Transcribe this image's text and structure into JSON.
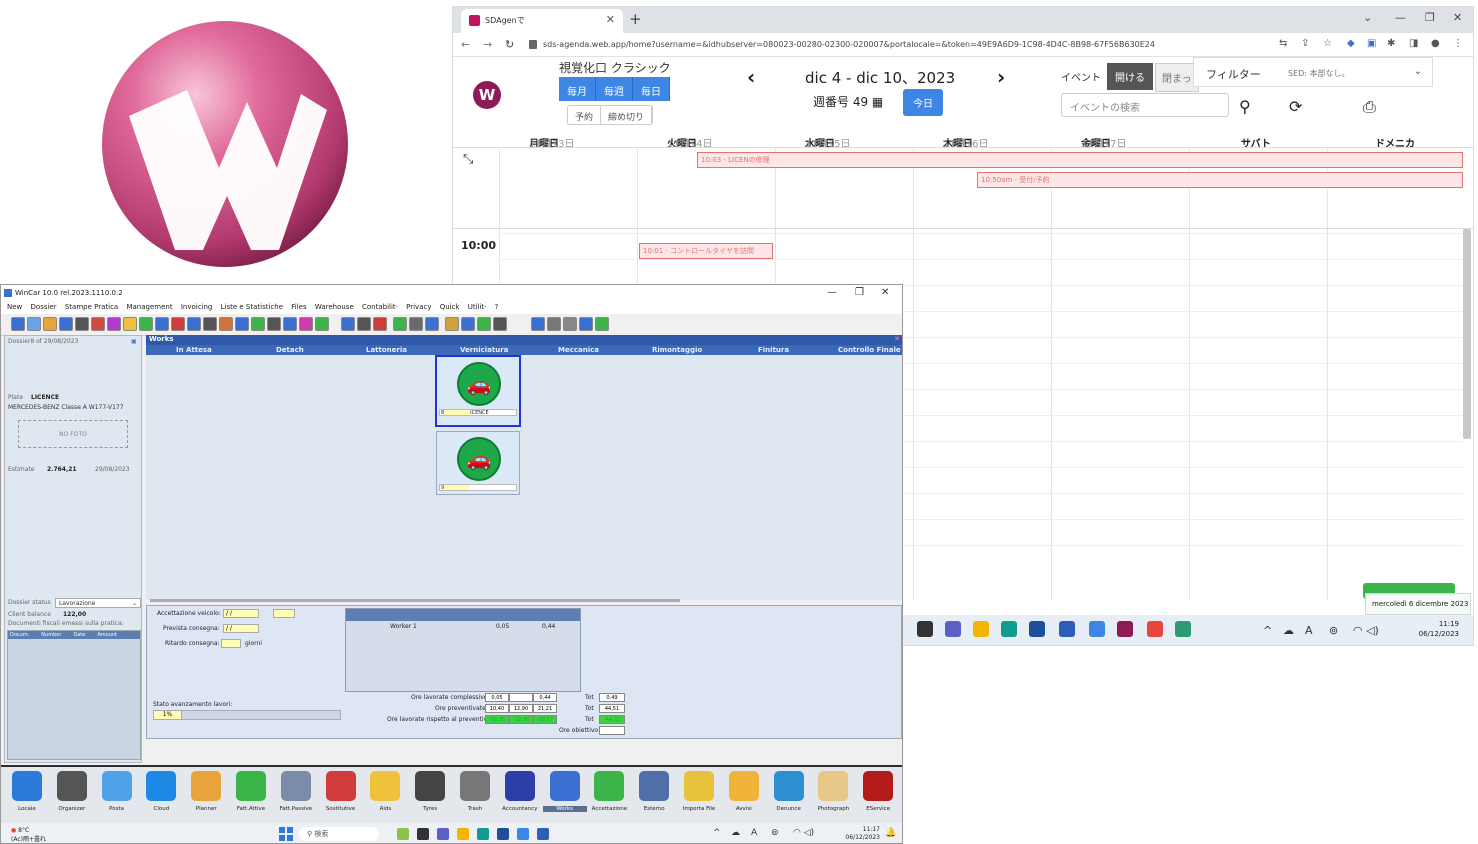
{
  "browser": {
    "tab_title": "SDAgenで",
    "url": "sds-agenda.web.app/home?username=&idhubserver=080023-00280-02300-020007&portalocale=&token=49E9A6D9-1C98-4D4C-8B98-67F56B630E24",
    "calendar": {
      "view_title": "視覚化口 クラシック",
      "views": [
        "毎月",
        "毎週",
        "毎日"
      ],
      "sub_views": [
        "予約",
        "締め切り"
      ],
      "date_range": "dic 4 - dic 10、2023",
      "week_label": "週番号 49",
      "today_button": "今日",
      "event_label": "イベント",
      "open_button": "開ける",
      "close_button": "閉まっ",
      "filter_label": "フィルター",
      "filter_value": "SED: 本部なし。",
      "search_placeholder": "イベントの検索",
      "days": [
        {
          "date": "11月13日",
          "name": "月曜日"
        },
        {
          "date": "11月14日",
          "name": "火曜日"
        },
        {
          "date": "11月15日",
          "name": "水曜日"
        },
        {
          "date": "11月16日",
          "name": "木曜日"
        },
        {
          "date": "11月17日",
          "name": "金曜日"
        },
        {
          "date": "",
          "name": "サバト"
        },
        {
          "date": "",
          "name": "ドメニカ"
        }
      ],
      "allday_events": [
        "10:03 - LICENの修理",
        "10:50am - 受付/予約"
      ],
      "time_label": "10:00",
      "timed_event": "10:01 - コントロールタイヤを訪問",
      "notification": "mercoledì 6 dicembre 2023"
    },
    "taskbar": {
      "time": "11:19",
      "date": "06/12/2023"
    }
  },
  "wincar": {
    "title": "WinCar 10.0 rel.2023.1110.0.2",
    "menu": [
      "New",
      "Dossier",
      "Stampe Pratica",
      "Management",
      "Invoicing",
      "Liste e Statistiche",
      "Files",
      "Warehouse",
      "Contabilit·",
      "Privacy",
      "Quick",
      "Utilit·",
      "?"
    ],
    "left": {
      "dossier_line": "Dossier8 of 29/08/2023",
      "plate_label": "Plate",
      "plate_value": "LICENCE",
      "vehicle": "MERCEDES-BENZ Classe A W177-V177",
      "no_photo": "NO FOTO",
      "estimate_label": "Estimate",
      "estimate_value": "2.764,21",
      "estimate_date": "29/08/2023",
      "status_label": "Dossier status",
      "status_value": "Lavorazione",
      "balance_label": "Client balance",
      "balance_value": "122,00",
      "docs_label": "Documenti fiscali emessi sulla pratica:",
      "doc_columns": [
        "Docum.",
        "Number",
        "Date",
        "Amount"
      ]
    },
    "works": {
      "title": "Works",
      "columns": [
        "In Attesa",
        "Detach",
        "Lattoneria",
        "Verniciatura",
        "Meccanica",
        "Rimontaggio",
        "Finitura",
        "Controllo Finale"
      ],
      "card1_num": "8",
      "card1_plate": "LICENCE",
      "card2_num": "9"
    },
    "bottom": {
      "acceptance_label": "Accettazione veicolo:",
      "acceptance_value": "/ /",
      "delivery_label": "Prevista consegna:",
      "delivery_value": "/ /",
      "delay_label": "Ritardo consegna:",
      "delay_unit": "giorni",
      "worker": "Worker 1",
      "worker_hours_a": "0,05",
      "worker_hours_b": "0,44",
      "row1_label": "Ore lavorate complessive:",
      "row1": [
        "0,05",
        "",
        "0,44"
      ],
      "row1_tot": "0,49",
      "row2_label": "Ore preventivate:",
      "row2": [
        "10,40",
        "12,90",
        "21,21"
      ],
      "row2_tot": "44,51",
      "row3_label": "Ore lavorate rispetto al preventivo:",
      "row3": [
        "-10,35",
        "-12,90",
        "-20,77"
      ],
      "row3_tot": "-44,02",
      "row4_label": "Ore obiettivo:",
      "tot_label": "Tot",
      "progress_label": "Stato avanzamento lavori:",
      "progress_value": "1%"
    },
    "dock": [
      "Locale",
      "Organizer",
      "Posta",
      "Cloud",
      "Planner",
      "Fatt.Attive",
      "Fatt.Passive",
      "Sostitutive",
      "Aids",
      "Tyres",
      "Trash",
      "Accountancy",
      "Works",
      "Accettazione",
      "Esterno",
      "Importa File",
      "Avvisi",
      "Denunce",
      "Photograph",
      "EService"
    ],
    "taskbar": {
      "weather": "8°C",
      "weather_sub": "(Ac)雨+曇れ",
      "search": "検索",
      "time": "11:17",
      "date": "06/12/2023"
    }
  }
}
